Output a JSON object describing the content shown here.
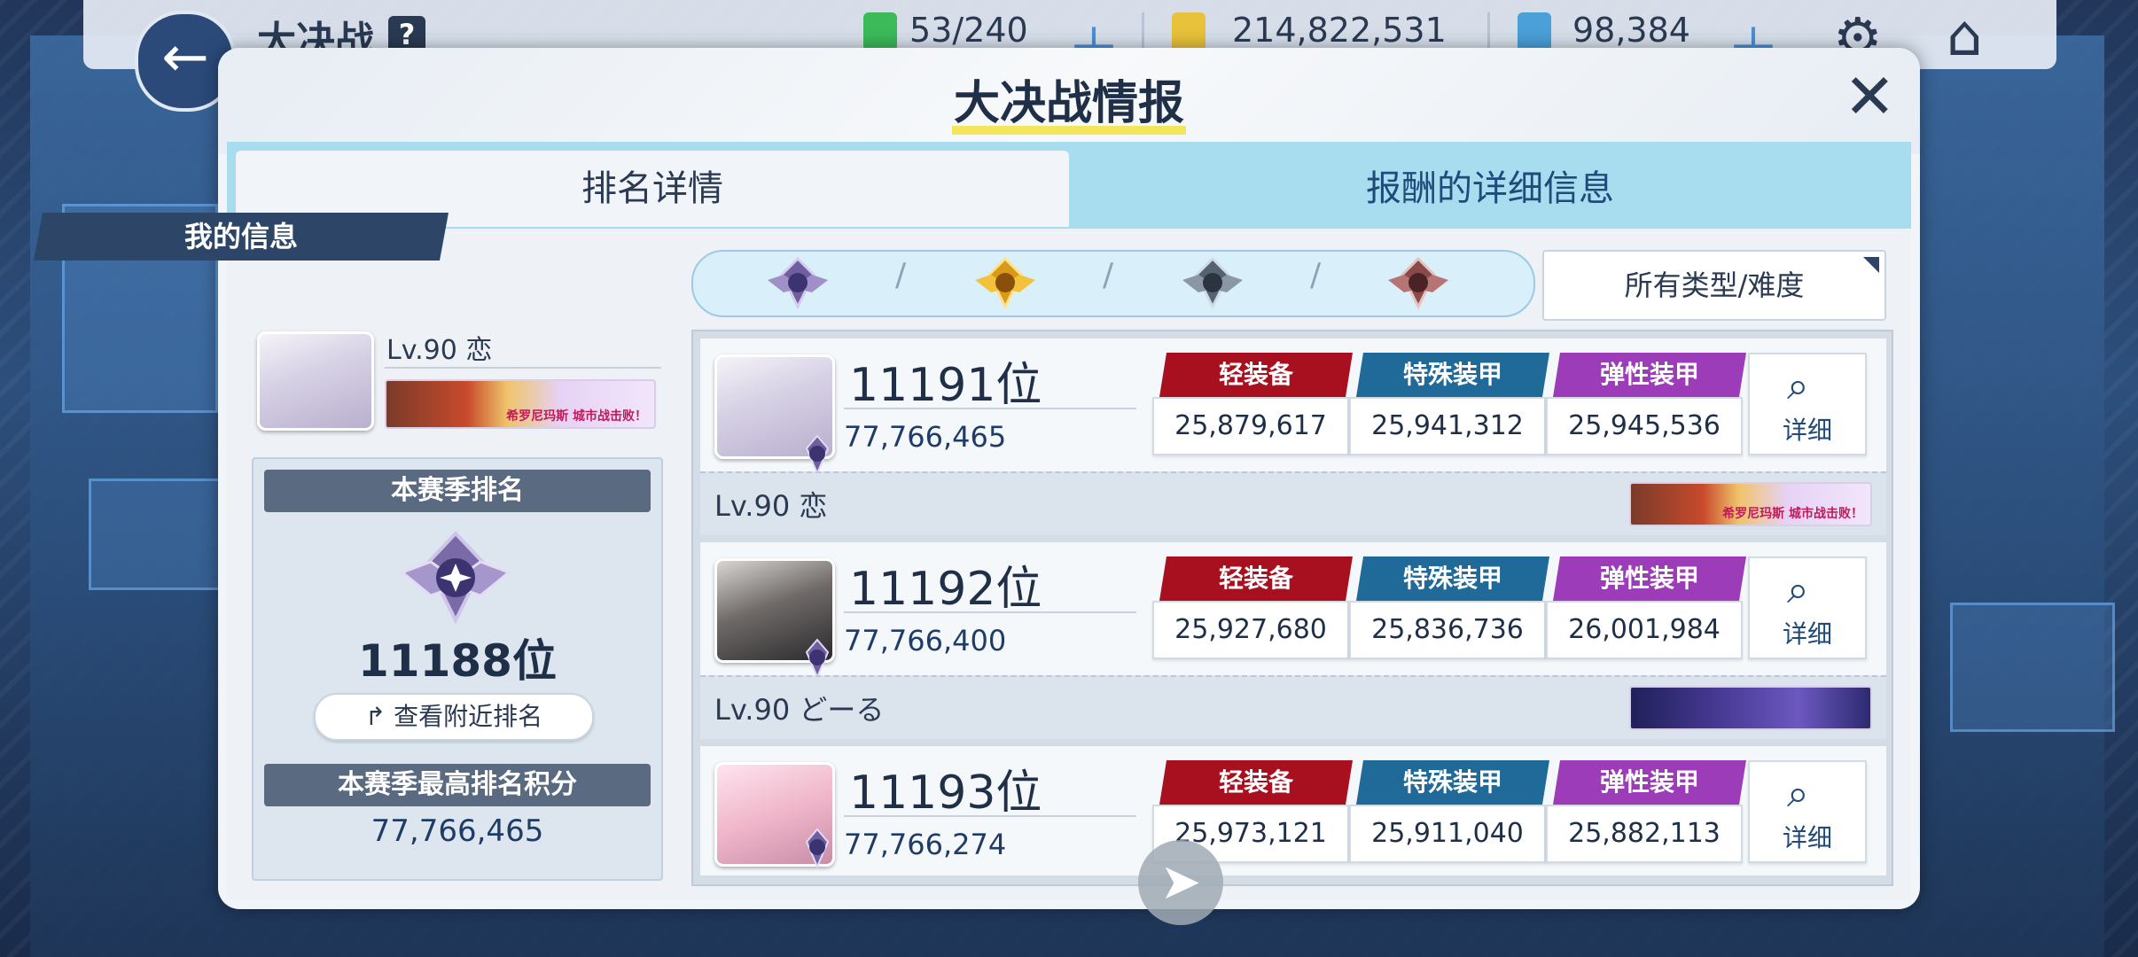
{
  "topbar": {
    "title": "大决战",
    "help": "?",
    "stamina": "53/240",
    "credits": "214,822,531",
    "gems": "98,384",
    "plus": "＋"
  },
  "modal": {
    "title": "大决战情报",
    "close": "✕",
    "tabs": [
      {
        "label": "排名详情"
      },
      {
        "label": "报酬的详细信息"
      }
    ]
  },
  "my_info": {
    "header": "我的信息",
    "level_name": "Lv.90 恋",
    "banner_text": "希罗尼玛斯 城市战击败！",
    "season_rank_header": "本赛季排名",
    "rank": "11188位",
    "nearby_label": "查看附近排名",
    "best_score_header": "本赛季最高排名积分",
    "best_score": "77,766,465"
  },
  "filter": {
    "separator": "/",
    "dropdown_label": "所有类型/难度"
  },
  "ranking": {
    "categories": [
      "轻装备",
      "特殊装甲",
      "弹性装甲"
    ],
    "detail_label": "详细",
    "rows": [
      {
        "rank": "11191位",
        "score": "77,766,465",
        "values": [
          "25,879,617",
          "25,941,312",
          "25,945,536"
        ],
        "player": "Lv.90 恋",
        "banner_text": "希罗尼玛斯 城市战击败！"
      },
      {
        "rank": "11192位",
        "score": "77,766,400",
        "values": [
          "25,927,680",
          "25,836,736",
          "26,001,984"
        ],
        "player": "Lv.90 どーる",
        "banner_text": ""
      },
      {
        "rank": "11193位",
        "score": "77,766,274",
        "values": [
          "25,973,121",
          "25,911,040",
          "25,882,113"
        ],
        "player": "",
        "banner_text": ""
      }
    ]
  },
  "colors": {
    "light_armor": "#a8101f",
    "special_armor": "#1f6a98",
    "elastic_armor": "#9c3cb8",
    "header_navy": "#2d4668",
    "tab_bar": "#a8dcef"
  }
}
